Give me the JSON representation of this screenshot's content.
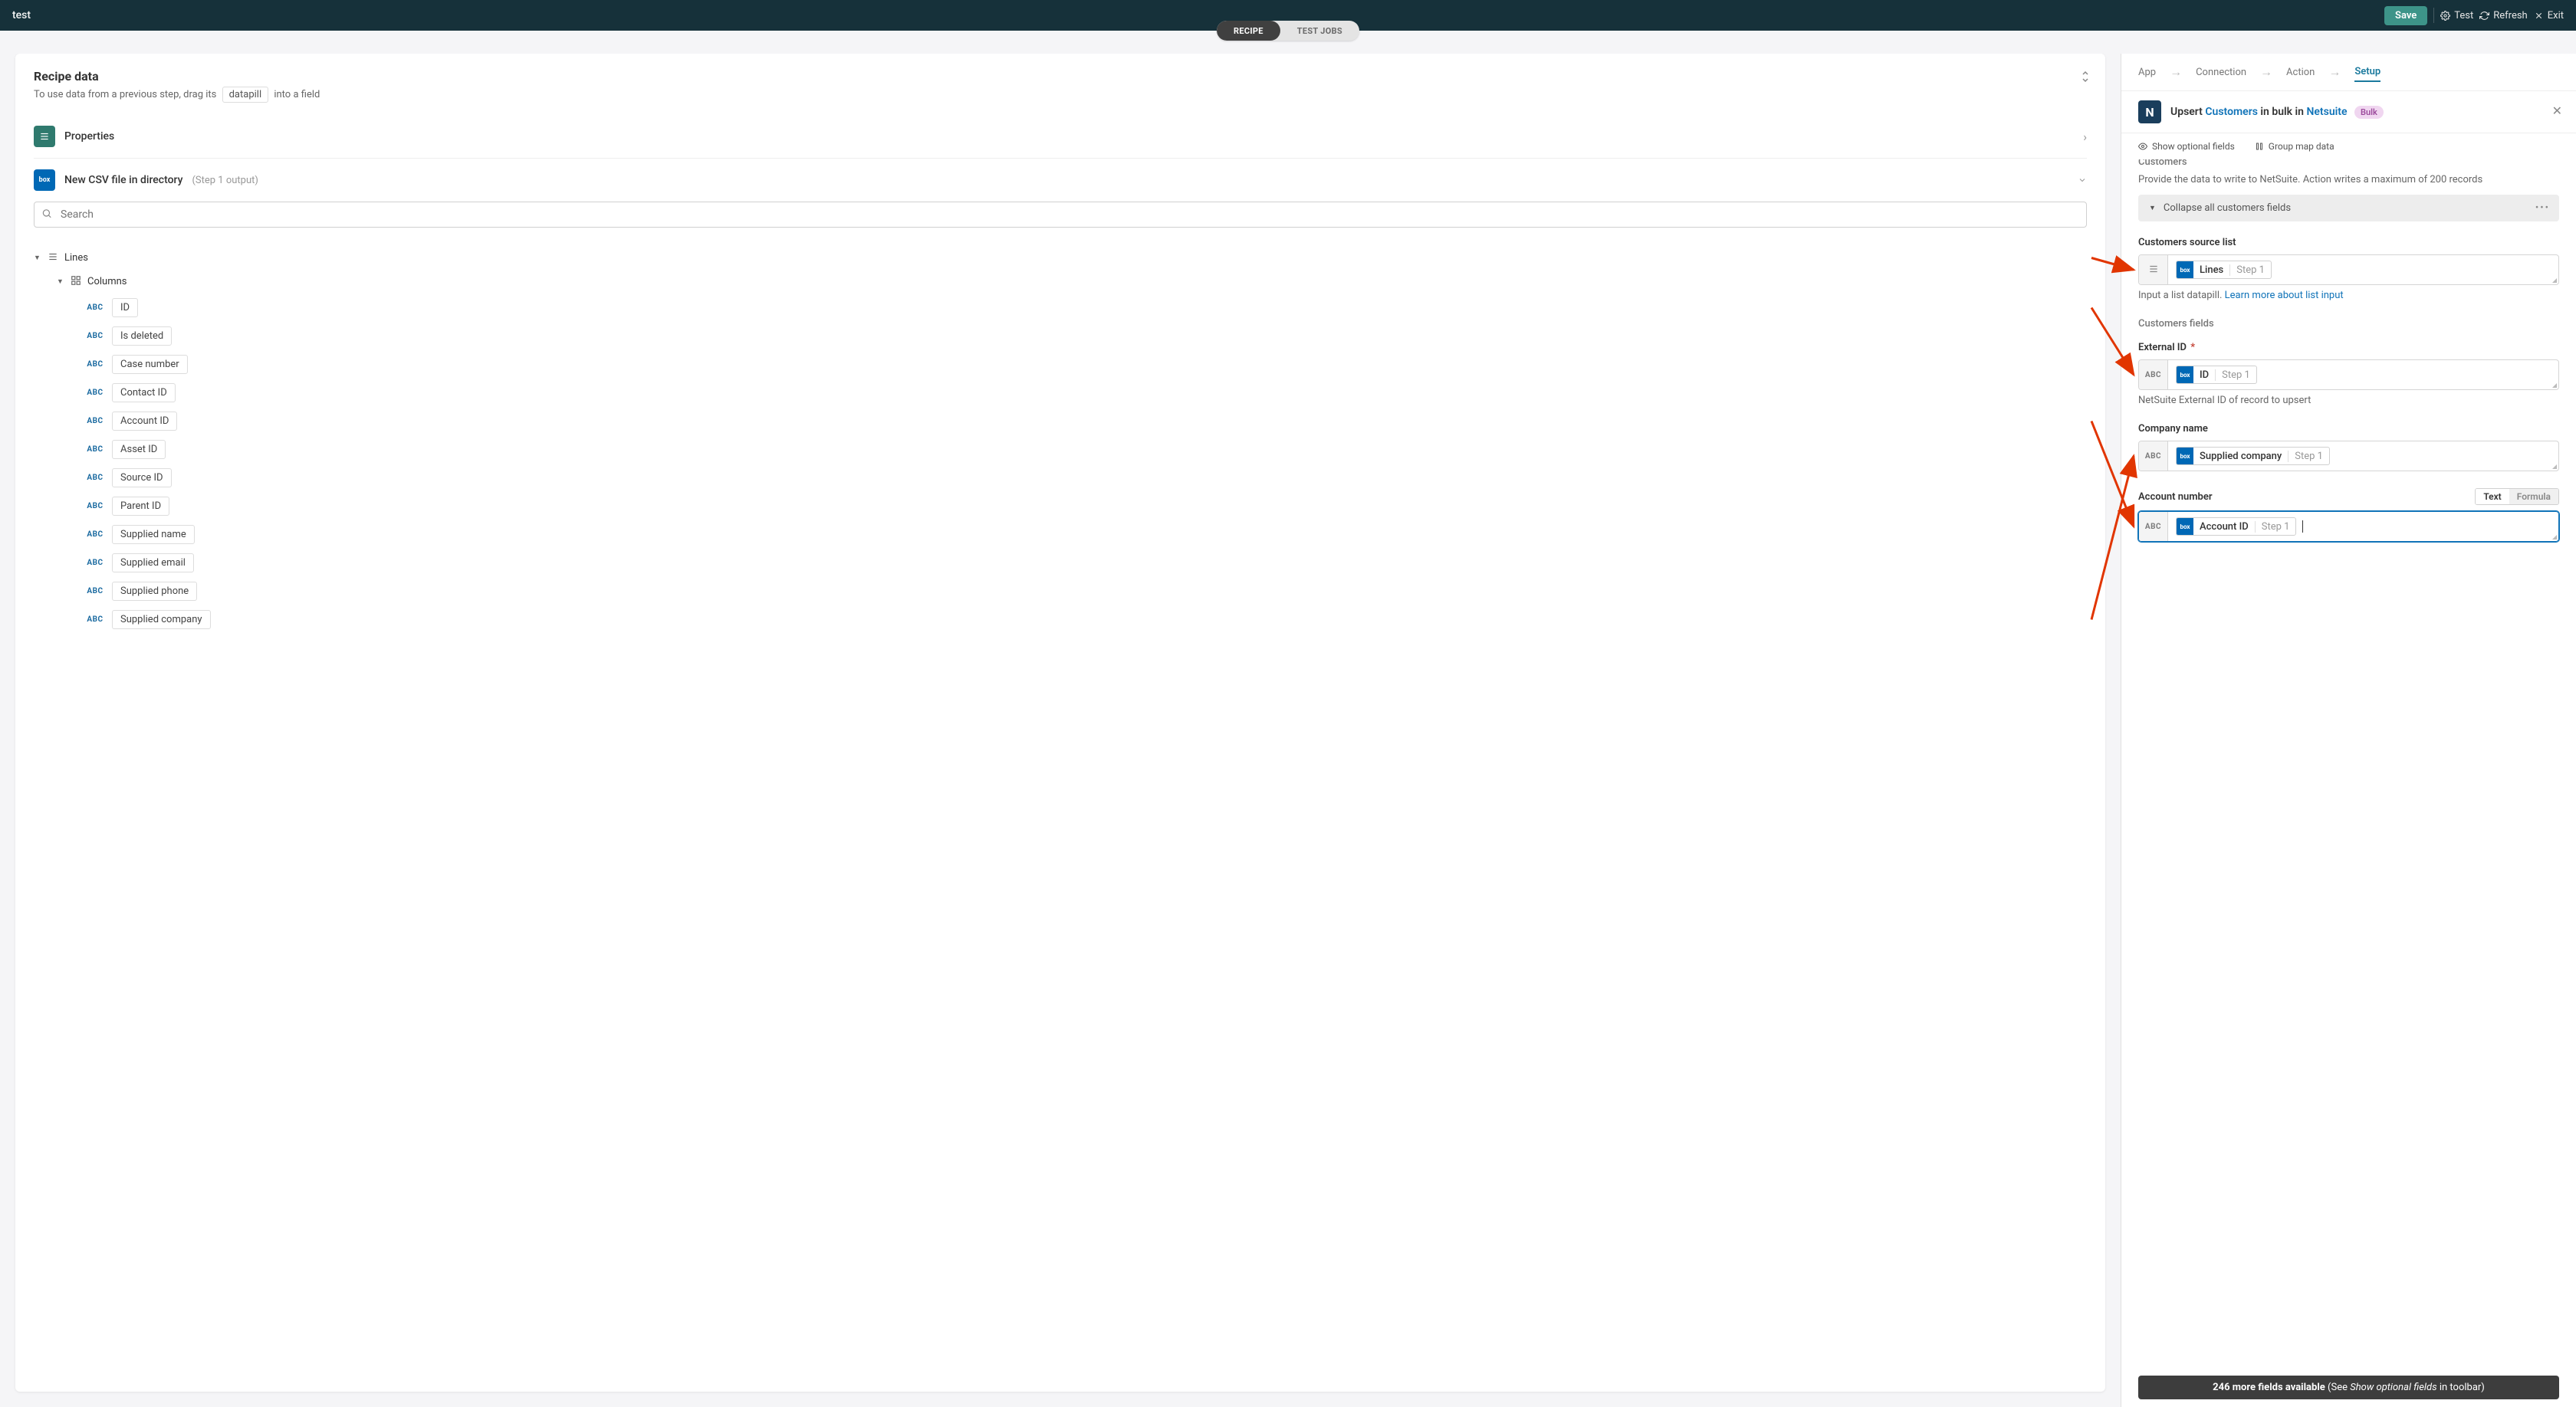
{
  "topbar": {
    "title": "test",
    "save": "Save",
    "test": "Test",
    "refresh": "Refresh",
    "exit": "Exit"
  },
  "tabs": {
    "recipe": "RECIPE",
    "testjobs": "TEST JOBS"
  },
  "recipe": {
    "title": "Recipe data",
    "subtitle_pre": "To use data from a previous step, drag its",
    "subtitle_chip": "datapill",
    "subtitle_post": "into a field"
  },
  "tree": {
    "properties": "Properties",
    "step1_label": "New CSV file in directory",
    "step1_meta": "(Step 1 output)",
    "search_placeholder": "Search",
    "lines": "Lines",
    "columns": "Columns",
    "fields": [
      "ID",
      "Is deleted",
      "Case number",
      "Contact ID",
      "Account ID",
      "Asset ID",
      "Source ID",
      "Parent ID",
      "Supplied name",
      "Supplied email",
      "Supplied phone",
      "Supplied company"
    ]
  },
  "right": {
    "bc": {
      "app": "App",
      "connection": "Connection",
      "action": "Action",
      "setup": "Setup"
    },
    "action_label": {
      "pre": "Upsert ",
      "link1": "Customers",
      "mid": " in bulk in ",
      "link2": "Netsuite"
    },
    "bulk_badge": "Bulk",
    "show_optional": "Show optional fields",
    "group_map": "Group map data",
    "customers_label": "Customers",
    "customers_desc": "Provide the data to write to NetSuite. Action writes a maximum of 200 records",
    "collapse": "Collapse all customers fields",
    "f_source": {
      "label": "Customers source list",
      "help_pre": "Input a list datapill. ",
      "help_link": "Learn more about list input",
      "pill_label": "Lines",
      "pill_meta": "Step 1"
    },
    "f_fields_header": "Customers fields",
    "f_extid": {
      "label": "External ID",
      "required": true,
      "help": "NetSuite External ID of record to upsert",
      "pill_label": "ID",
      "pill_meta": "Step 1"
    },
    "f_company": {
      "label": "Company name",
      "pill_label": "Supplied company",
      "pill_meta": "Step 1"
    },
    "f_acct": {
      "label": "Account number",
      "mode_text": "Text",
      "mode_formula": "Formula",
      "pill_label": "Account ID",
      "pill_meta": "Step 1"
    },
    "more_fields": {
      "pre": "246 more fields available ",
      "paren_pre": "(See ",
      "em": "Show optional fields",
      "paren_post": " in toolbar)"
    }
  }
}
